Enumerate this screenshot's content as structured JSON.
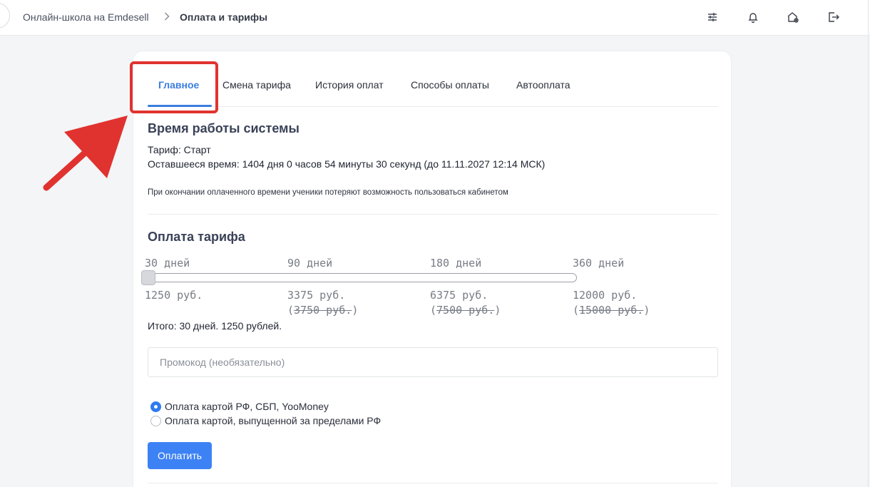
{
  "header": {
    "school_name": "Онлайн-школа на Emdesell",
    "separator": ">",
    "current_page": "Оплата и тарифы",
    "icons": [
      "sliders-icon",
      "bell-icon",
      "home-settings-icon",
      "logout-icon"
    ]
  },
  "tabs": [
    {
      "label": "Главное",
      "active": true
    },
    {
      "label": "Смена тарифа",
      "active": false
    },
    {
      "label": "История оплат",
      "active": false
    },
    {
      "label": "Способы оплаты",
      "active": false
    },
    {
      "label": "Автооплата",
      "active": false
    }
  ],
  "system_time": {
    "title": "Время работы системы",
    "tariff_line": "Тариф: Старт",
    "remaining_line": "Оставшееся время: 1404 дня 0 часов 54 минуты 30 секунд (до 11.11.2027 12:14 МСК)",
    "note": "При окончании оплаченного времени ученики потеряют возможность пользоваться кабинетом"
  },
  "payment": {
    "title": "Оплата тарифа",
    "options": [
      {
        "period": "30 дней",
        "price": "1250 руб.",
        "old_price": ""
      },
      {
        "period": "90 дней",
        "price": "3375 руб.",
        "old_price": "3750 руб."
      },
      {
        "period": "180 дней",
        "price": "6375 руб.",
        "old_price": "7500 руб."
      },
      {
        "period": "360 дней",
        "price": "12000 руб.",
        "old_price": "15000 руб."
      }
    ],
    "selected_index": 0,
    "total": "Итого: 30 дней. 1250 рублей.",
    "promo_placeholder": "Промокод (необязательно)",
    "methods": [
      {
        "label": "Оплата картой РФ, СБП, YooMoney",
        "checked": true
      },
      {
        "label": "Оплата картой, выпущенной за пределами РФ",
        "checked": false
      }
    ],
    "pay_button": "Оплатить"
  },
  "colors": {
    "accent": "#3b7de0",
    "button": "#3d82f4",
    "annotation": "#e0332f"
  }
}
